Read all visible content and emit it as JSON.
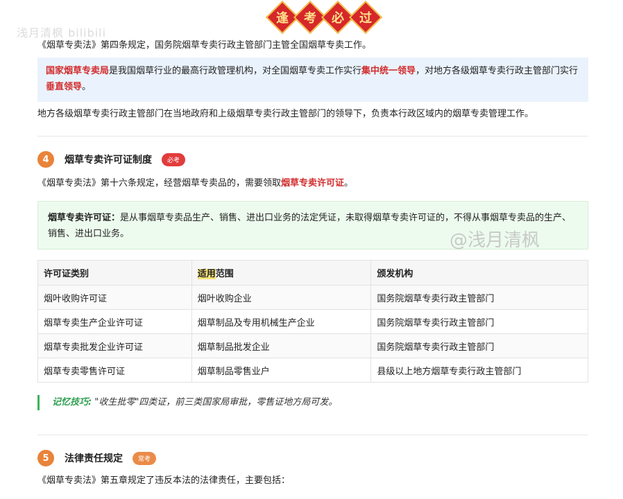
{
  "watermark_top": "浅月清枫 bilibili",
  "banner_chars": [
    "逢",
    "考",
    "必",
    "过"
  ],
  "intro_line": "《烟草专卖法》第四条规定，国务院烟草专卖行政主管部门主管全国烟草专卖工作。",
  "blue_box": {
    "p1": "国家烟草专卖局",
    "p2": "是我国烟草行业的最高行政管理机构，对全国烟草专卖工作实行",
    "p3": "集中统一领导",
    "p4": "，对地方各级烟草专卖行政主管部门实行",
    "p5": "垂直领导",
    "p6": "。"
  },
  "local_line": "地方各级烟草专卖行政主管部门在当地政府和上级烟草专卖行政主管部门的领导下，负责本行政区域内的烟草专卖管理工作。",
  "section4": {
    "num": "4",
    "title": "烟草专卖许可证制度",
    "tag": "必考",
    "line_a": "《烟草专卖法》第十六条规定，经营烟草专卖品的，需要领取",
    "line_b": "烟草专卖许可证",
    "line_c": "。"
  },
  "green_box": {
    "term": "烟草专卖许可证：",
    "text": "是从事烟草专卖品生产、销售、进出口业务的法定凭证，未取得烟草专卖许可证的，不得从事烟草专卖品的生产、销售、进出口业务。",
    "watermark": "@浅月清枫"
  },
  "table": {
    "headers": [
      "许可证类别",
      "适用",
      "范围",
      "颁发机构"
    ],
    "rows": [
      [
        "烟叶收购许可证",
        "烟叶收购企业",
        "国务院烟草专卖行政主管部门"
      ],
      [
        "烟草专卖生产企业许可证",
        "烟草制品及专用机械生产企业",
        "国务院烟草专卖行政主管部门"
      ],
      [
        "烟草专卖批发企业许可证",
        "烟草制品批发企业",
        "国务院烟草专卖行政主管部门"
      ],
      [
        "烟草专卖零售许可证",
        "烟草制品零售业户",
        "县级以上地方烟草专卖行政主管部门"
      ]
    ]
  },
  "tip": {
    "label": "记忆技巧:",
    "text": " \"收生批零\"四类证，前三类国家局审批，零售证地方局可发。"
  },
  "section5": {
    "num": "5",
    "title": "法律责任规定",
    "tag": "常考",
    "line": "《烟草专卖法》第五章规定了违反本法的法律责任，主要包括："
  },
  "colors": {
    "accent_red": "#d22d2d",
    "section_orange": "#e9833a",
    "tip_green": "#2f9e4f",
    "blue_box_bg": "#eaf3fd",
    "green_box_bg": "#edfbee"
  }
}
